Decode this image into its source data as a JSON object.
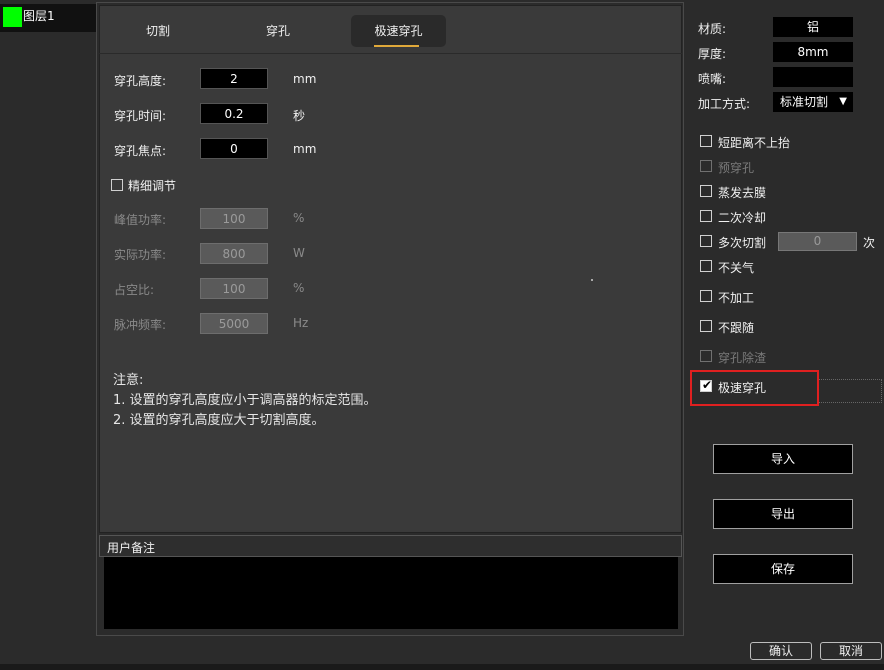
{
  "layers": {
    "items": [
      {
        "name": "图层1",
        "color": "#00ff00"
      }
    ]
  },
  "tabs": {
    "cut": "切割",
    "pierce": "穿孔",
    "fast_pierce": "极速穿孔",
    "active": "fast_pierce",
    "accent": "#e0a93a"
  },
  "form": {
    "pierce_height": {
      "label": "穿孔高度:",
      "value": "2",
      "unit": "mm"
    },
    "pierce_time": {
      "label": "穿孔时间:",
      "value": "0.2",
      "unit": "秒"
    },
    "pierce_focus": {
      "label": "穿孔焦点:",
      "value": "0",
      "unit": "mm"
    },
    "fine_adjust": {
      "label": "精细调节",
      "checked": false
    },
    "peak_power": {
      "label": "峰值功率:",
      "value": "100",
      "unit": "%"
    },
    "actual_power": {
      "label": "实际功率:",
      "value": "800",
      "unit": "W"
    },
    "duty_cycle": {
      "label": "占空比:",
      "value": "100",
      "unit": "%"
    },
    "pulse_freq": {
      "label": "脉冲频率:",
      "value": "5000",
      "unit": "Hz"
    }
  },
  "notes": {
    "title": "注意:",
    "line1": "1. 设置的穿孔高度应小于调高器的标定范围。",
    "line2": "2. 设置的穿孔高度应大于切割高度。"
  },
  "remark": {
    "title": "用户备注",
    "value": ""
  },
  "material": {
    "material_label": "材质:",
    "material_value": "铝",
    "thickness_label": "厚度:",
    "thickness_value": "8mm",
    "nozzle_label": "喷嘴:",
    "nozzle_value": "",
    "process_label": "加工方式:",
    "process_value": "标准切割"
  },
  "options": [
    {
      "id": "short_no_lift",
      "label": "短距离不上抬",
      "checked": false,
      "enabled": true
    },
    {
      "id": "pre_pierce",
      "label": "预穿孔",
      "checked": false,
      "enabled": false
    },
    {
      "id": "evaporate_film",
      "label": "蒸发去膜",
      "checked": false,
      "enabled": true
    },
    {
      "id": "secondary_cool",
      "label": "二次冷却",
      "checked": false,
      "enabled": true
    },
    {
      "id": "multi_cut",
      "label": "多次切割",
      "checked": false,
      "enabled": true
    },
    {
      "id": "keep_gas",
      "label": "不关气",
      "checked": false,
      "enabled": true
    },
    {
      "id": "no_process",
      "label": "不加工",
      "checked": false,
      "enabled": true
    },
    {
      "id": "no_follow",
      "label": "不跟随",
      "checked": false,
      "enabled": true
    },
    {
      "id": "pierce_slag",
      "label": "穿孔除渣",
      "checked": false,
      "enabled": false
    },
    {
      "id": "fast_pierce",
      "label": "极速穿孔",
      "checked": true,
      "enabled": true
    }
  ],
  "multi_cut_count": {
    "value": "0",
    "unit": "次"
  },
  "buttons": {
    "import": "导入",
    "export": "导出",
    "save": "保存",
    "ok": "确认",
    "cancel": "取消"
  }
}
